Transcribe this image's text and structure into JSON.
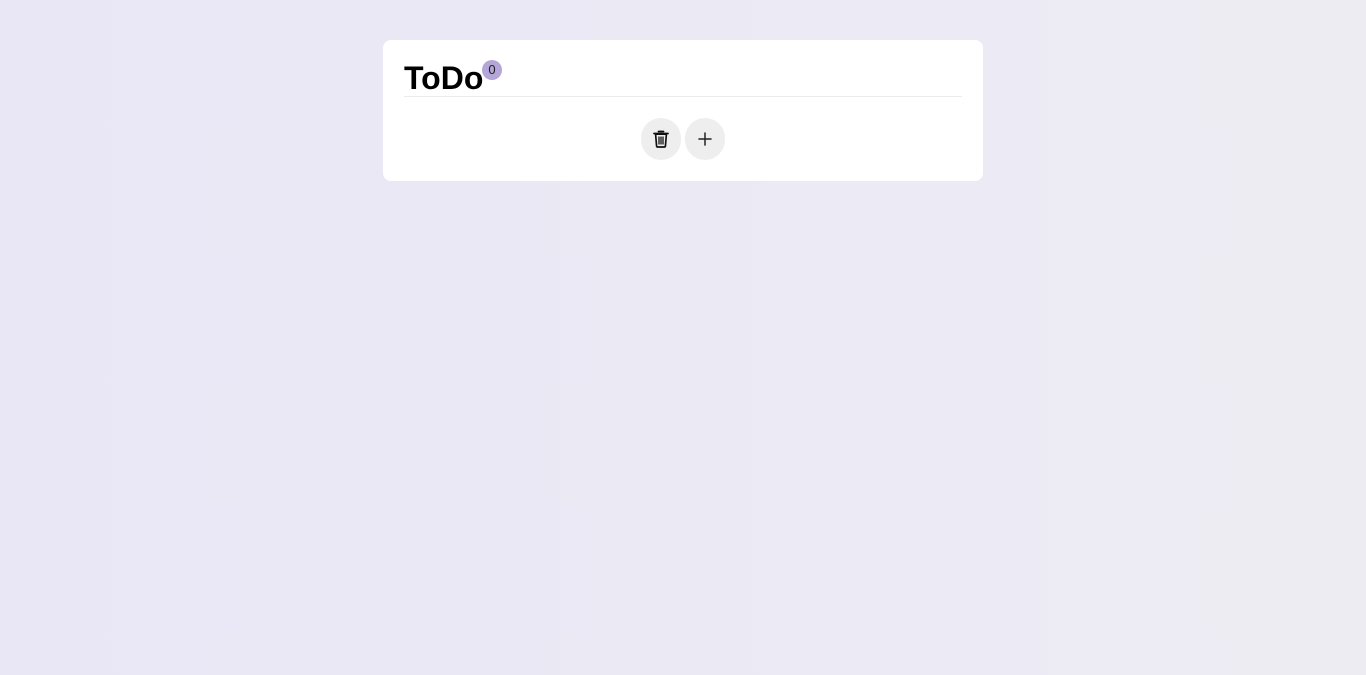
{
  "app": {
    "title": "ToDo",
    "count": "0"
  },
  "actions": {
    "delete_icon": "trash-icon",
    "add_icon": "plus-icon"
  },
  "colors": {
    "background": "#ebe8f5",
    "card": "#ffffff",
    "badge": "#b4a6d8",
    "button": "#eeeeee"
  }
}
